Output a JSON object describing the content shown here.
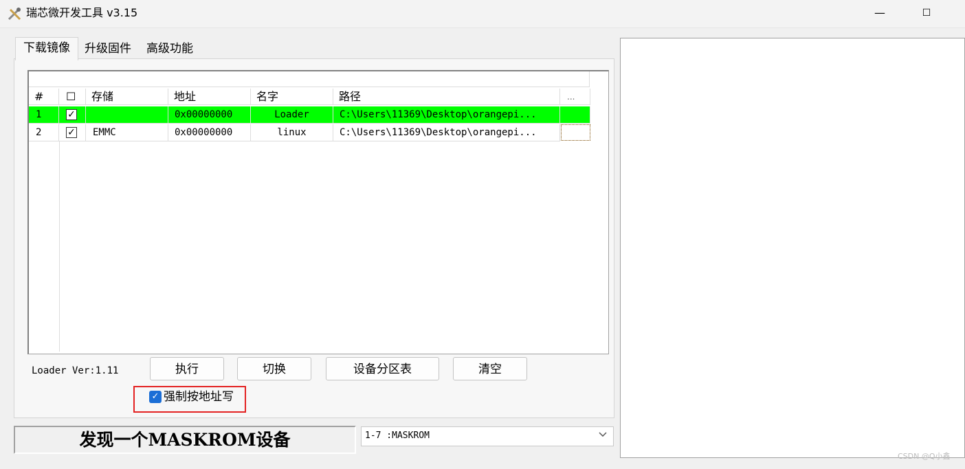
{
  "window": {
    "title": "瑞芯微开发工具 v3.15",
    "icon": "tools-icon"
  },
  "title_controls": {
    "minimize": "—",
    "maximize": "☐"
  },
  "tabs": [
    "下载镜像",
    "升级固件",
    "高级功能"
  ],
  "table": {
    "columns": [
      "#",
      "☐",
      "存储",
      "地址",
      "名字",
      "路径",
      "..."
    ],
    "rows": [
      {
        "num": "1",
        "checked": "✓",
        "storage": "",
        "address": "0x00000000",
        "name": "Loader",
        "path": "C:\\Users\\11369\\Desktop\\orangepi...",
        "highlight": "#00ff00"
      },
      {
        "num": "2",
        "checked": "✓",
        "storage": "EMMC",
        "address": "0x00000000",
        "name": "linux",
        "path": "C:\\Users\\11369\\Desktop\\orangepi..."
      }
    ]
  },
  "loader_version": "Loader Ver:1.11",
  "buttons": {
    "execute": "执行",
    "switch": "切换",
    "partition_table": "设备分区表",
    "clear": "清空"
  },
  "force_address_write": {
    "checked": "✓",
    "label": "强制按地址写"
  },
  "status_text": "发现一个MASKROM设备",
  "device_select": {
    "value": "1-7 :MASKROM"
  },
  "watermark": "CSDN @Q小鑫",
  "colors": {
    "highlight_row": "#00ff00",
    "callout_border": "#e32020",
    "checkbox_accent": "#1b6ed6"
  }
}
